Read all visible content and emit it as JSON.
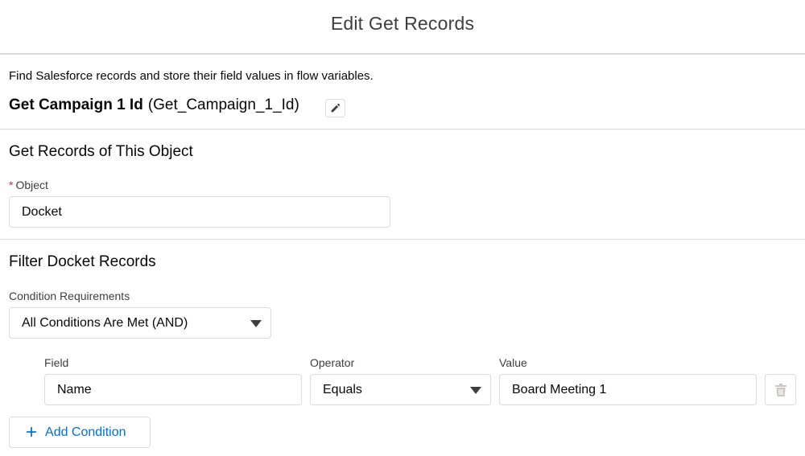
{
  "header": {
    "title": "Edit Get Records"
  },
  "description": "Find Salesforce records and store their field values in flow variables.",
  "element": {
    "label": "Get Campaign 1 Id",
    "api_name": "(Get_Campaign_1_Id)"
  },
  "object_section": {
    "title": "Get Records of This Object",
    "required_mark": "*",
    "object_label": "Object",
    "object_value": "Docket"
  },
  "filter_section": {
    "title": "Filter Docket Records",
    "condition_req_label": "Condition Requirements",
    "condition_req_value": "All Conditions Are Met (AND)",
    "columns": {
      "field": "Field",
      "operator": "Operator",
      "value": "Value"
    },
    "conditions": [
      {
        "field": "Name",
        "operator": "Equals",
        "value": "Board Meeting 1"
      }
    ],
    "add_label": "Add Condition"
  },
  "icons": {
    "edit": "pencil-icon",
    "delete": "trash-icon",
    "add": "plus-icon",
    "dropdown": "caret-down-icon"
  },
  "colors": {
    "link": "#0070d2",
    "required": "#c23934",
    "border": "#dddbda"
  }
}
